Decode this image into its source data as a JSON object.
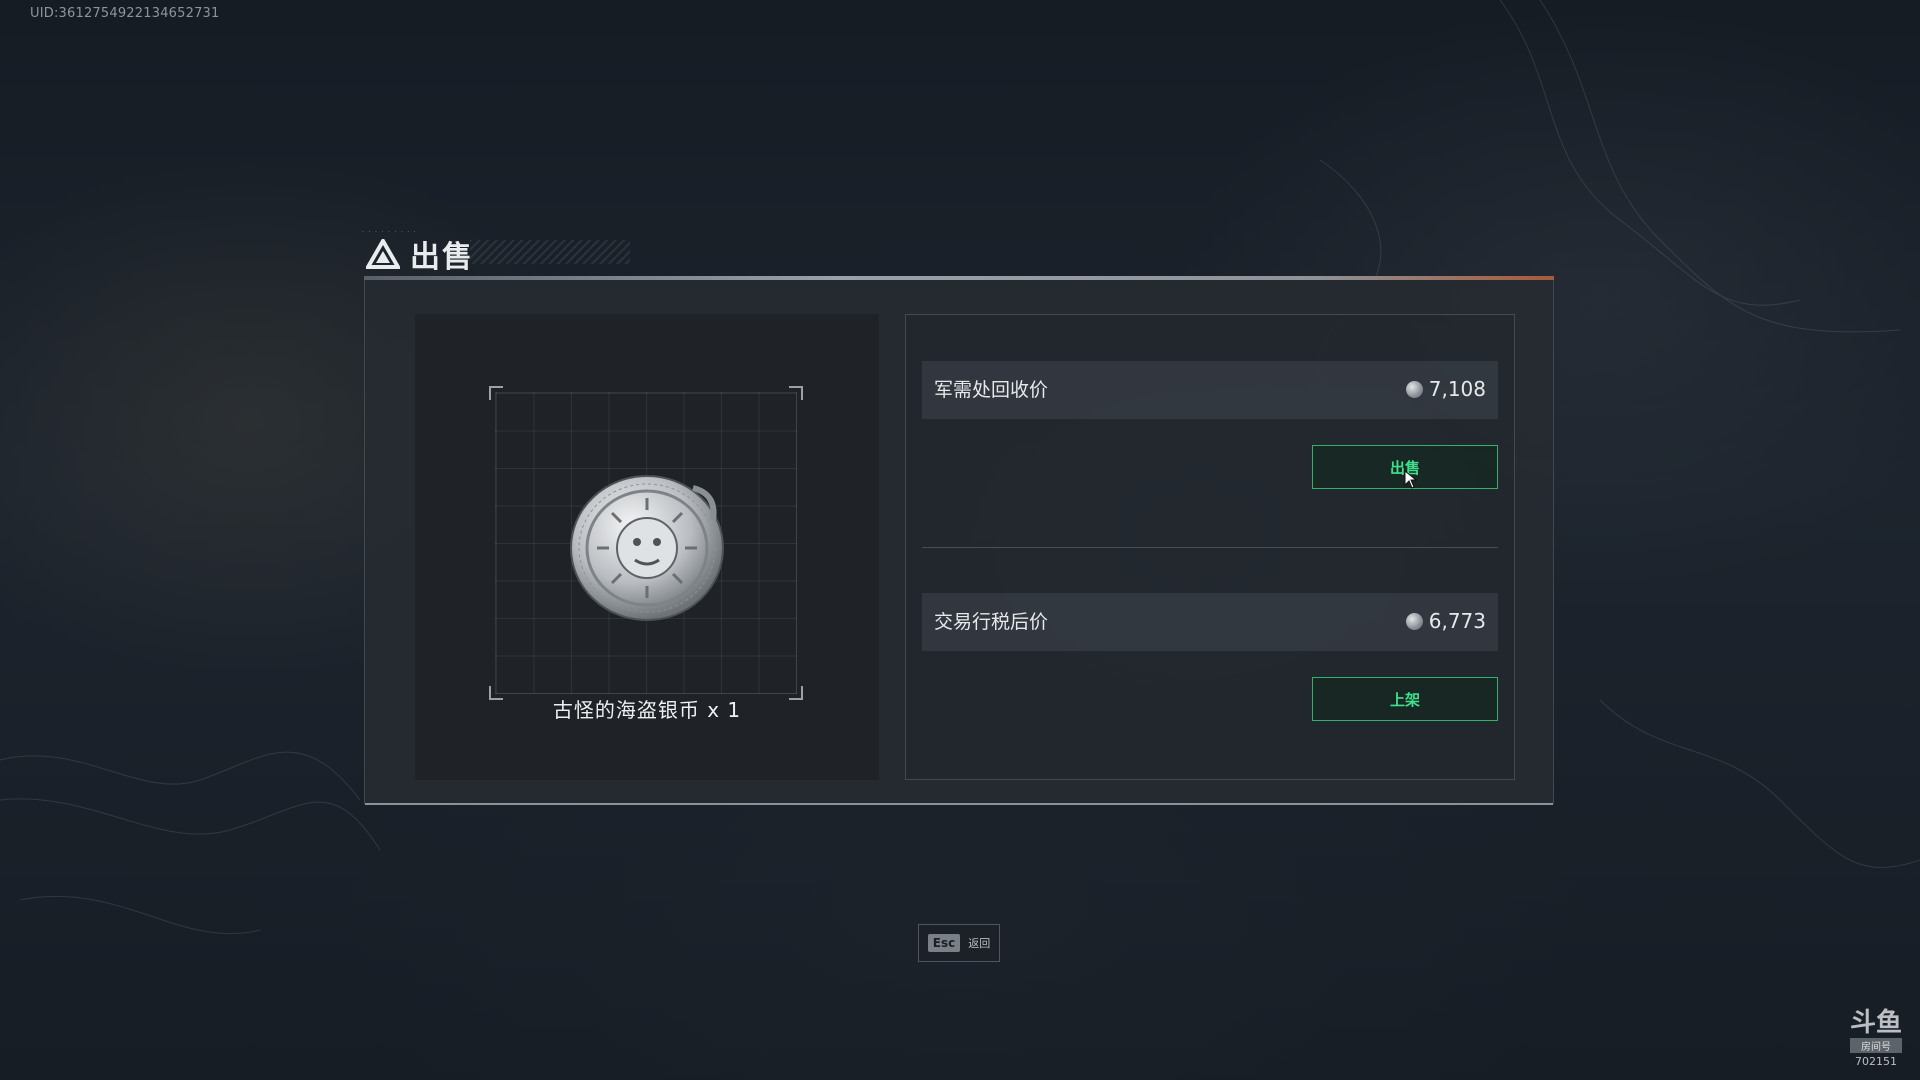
{
  "uid": "UID:3612754922134652731",
  "panel": {
    "title": "出售"
  },
  "item": {
    "name": "古怪的海盗银币 x 1"
  },
  "recycle": {
    "label": "军需处回收价",
    "price": "7,108",
    "button": "出售"
  },
  "market": {
    "label": "交易行税后价",
    "price": "6,773",
    "button": "上架"
  },
  "footer": {
    "key": "Esc",
    "action": "返回"
  },
  "watermark": {
    "logo": "斗鱼",
    "badge": "房间号",
    "room": "702151"
  },
  "colors": {
    "accent_green": "#3fe08a",
    "border_green": "#2fb36a"
  }
}
